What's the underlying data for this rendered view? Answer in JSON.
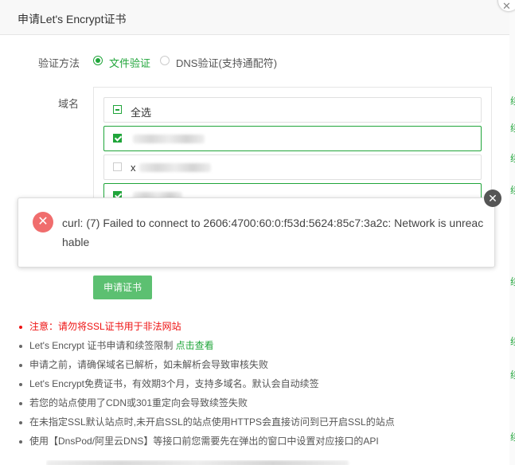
{
  "dialog": {
    "title": "申请Let's Encrypt证书",
    "close_glyph": "✕"
  },
  "verify": {
    "label": "验证方法",
    "options": [
      {
        "label": "文件验证",
        "selected": true
      },
      {
        "label": "DNS验证(支持通配符)",
        "selected": false
      }
    ]
  },
  "domains": {
    "label": "域名",
    "select_all": "全选",
    "items": [
      {
        "text": "",
        "checked": true
      },
      {
        "text": "x",
        "checked": false
      },
      {
        "text": "",
        "checked": true
      }
    ]
  },
  "error": {
    "message": "curl: (7) Failed to connect to 2606:4700:60:0:f53d:5624:85c7:3a2c: Network is unreachable",
    "icon": "✕",
    "close_glyph": "✕"
  },
  "submit_label": "申请证书",
  "notes": [
    {
      "text": "注意：请勿将SSL证书用于非法网站"
    },
    {
      "text": "Let's Encrypt 证书申请和续签限制 ",
      "link": "点击查看"
    },
    {
      "text": "申请之前，请确保域名已解析，如未解析会导致审核失败"
    },
    {
      "text": "Let's Encrypt免费证书，有效期3个月，支持多域名。默认会自动续签"
    },
    {
      "text": "若您的站点使用了CDN或301重定向会导致续签失败"
    },
    {
      "text": "在未指定SSL默认站点时,未开启SSL的站点使用HTTPS会直接访问到已开启SSL的站点"
    },
    {
      "text": "使用【DnsPod/阿里云DNS】等接口前您需要先在弹出的窗口中设置对应接口的API"
    }
  ],
  "colors": {
    "accent": "#20a53a",
    "button": "#5cc071",
    "error_icon": "#f06d6d",
    "warning_text": "#ee1111"
  }
}
